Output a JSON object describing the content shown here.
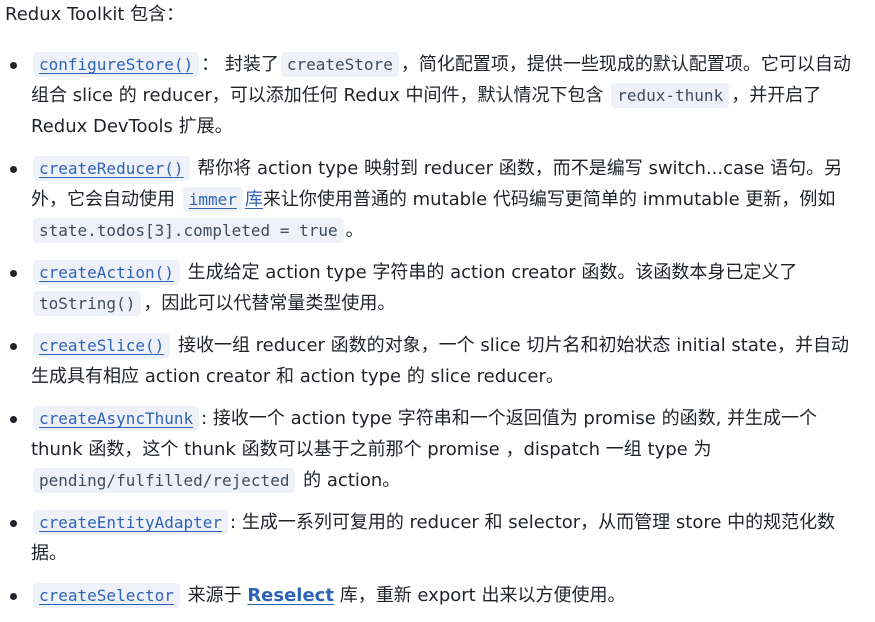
{
  "intro": "Redux Toolkit 包含：",
  "items": [
    {
      "parts": [
        {
          "code": "configureStore()",
          "link": true
        },
        {
          "text": "： 封装了"
        },
        {
          "code": "createStore",
          "link": false
        },
        {
          "text": "，简化配置项，提供一些现成的默认配置项。它可以自动组合 slice 的 reducer，可以添加任何 Redux 中间件，默认情况下包含 "
        },
        {
          "code": "redux-thunk",
          "link": false
        },
        {
          "text": "，并开启了 Redux DevTools 扩展。"
        }
      ]
    },
    {
      "parts": [
        {
          "code": "createReducer()",
          "link": true
        },
        {
          "text": " 帮你将 action type 映射到 reducer 函数，而不是编写 switch...case 语句。另外，它会自动使用 "
        },
        {
          "code": "immer",
          "link": true
        },
        {
          "link_text": "库"
        },
        {
          "text": "来让你使用普通的 mutable 代码编写更简单的 immutable 更新，例如 "
        },
        {
          "code": "state.todos[3].completed = true",
          "link": false
        },
        {
          "text": "。"
        }
      ]
    },
    {
      "parts": [
        {
          "code": "createAction()",
          "link": true
        },
        {
          "text": " 生成给定 action type 字符串的 action creator 函数。该函数本身已定义了 "
        },
        {
          "code": "toString()",
          "link": false
        },
        {
          "text": "，因此可以代替常量类型使用。"
        }
      ]
    },
    {
      "parts": [
        {
          "code": "createSlice()",
          "link": true
        },
        {
          "text": " 接收一组 reducer 函数的对象，一个 slice 切片名和初始状态 initial state，并自动生成具有相应 action creator 和 action type 的 slice reducer。"
        }
      ]
    },
    {
      "parts": [
        {
          "code": "createAsyncThunk",
          "link": true
        },
        {
          "text": ": 接收一个 action type 字符串和一个返回值为 promise 的函数, 并生成一个 thunk 函数，这个 thunk 函数可以基于之前那个 promise ，dispatch 一组 type 为 "
        },
        {
          "code": "pending/fulfilled/rejected",
          "link": false
        },
        {
          "text": " 的 action。"
        }
      ]
    },
    {
      "parts": [
        {
          "code": "createEntityAdapter",
          "link": true
        },
        {
          "text": ": 生成一系列可复用的 reducer 和 selector，从而管理 store 中的规范化数据。"
        }
      ]
    },
    {
      "parts": [
        {
          "code": "createSelector",
          "link": true
        },
        {
          "text": " 来源于 "
        },
        {
          "link_text": "Reselect",
          "bold": true
        },
        {
          "text": " 库，重新 export 出来以方便使用。"
        }
      ]
    }
  ]
}
